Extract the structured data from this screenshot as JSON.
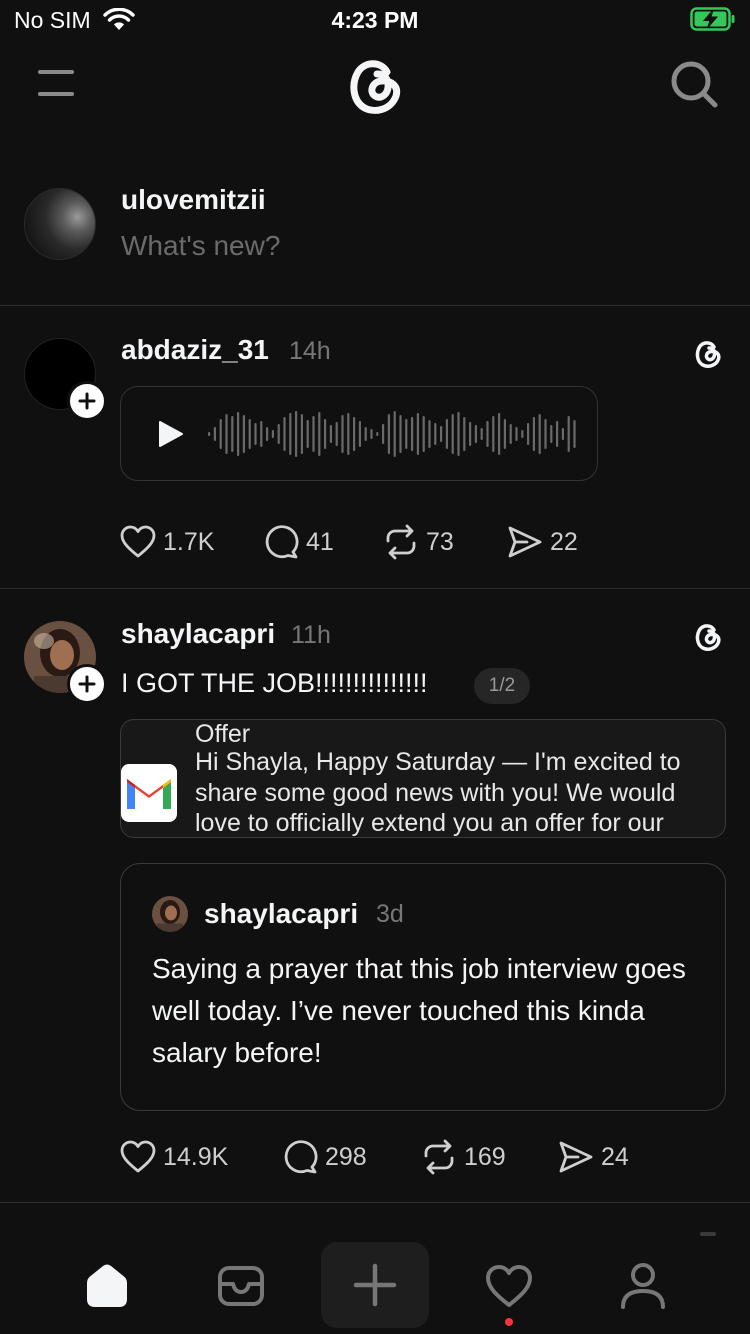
{
  "status_bar": {
    "carrier": "No SIM",
    "time": "4:23 PM"
  },
  "header": {
    "menu_icon": "hamburger-icon",
    "logo_icon": "threads-logo",
    "search_icon": "search-icon"
  },
  "composer": {
    "username": "ulovemitzii",
    "placeholder": "What's new?"
  },
  "posts": [
    {
      "username": "abdaziz_31",
      "time": "14h",
      "media": "voice-note",
      "actions": {
        "likes": "1.7K",
        "replies": "41",
        "reposts": "73",
        "shares": "22"
      }
    },
    {
      "username": "shaylacapri",
      "time": "11h",
      "text": "I GOT THE JOB!!!!!!!!!!!!!!!",
      "page_indicator": "1/2",
      "attachment": {
        "app_icon": "gmail-icon",
        "title": "Offer",
        "body": "Hi Shayla, Happy Saturday — I'm excited to share some good news with you! We would love to officially extend you an offer for our"
      },
      "quoted": {
        "username": "shaylacapri",
        "time": "3d",
        "text": "Saying a prayer that this job interview goes well today. I’ve never touched this kinda salary before!"
      },
      "actions": {
        "likes": "14.9K",
        "replies": "298",
        "reposts": "169",
        "shares": "24"
      }
    }
  ],
  "tabbar": {
    "items": [
      "home-icon",
      "inbox-icon",
      "new-thread-icon",
      "activity-heart-icon",
      "profile-icon"
    ],
    "has_activity_dot": true
  },
  "colors": {
    "background": "#101010",
    "text": "#f3f5f7",
    "muted": "#777777",
    "notification": "#ff3040",
    "battery": "#34c759"
  }
}
